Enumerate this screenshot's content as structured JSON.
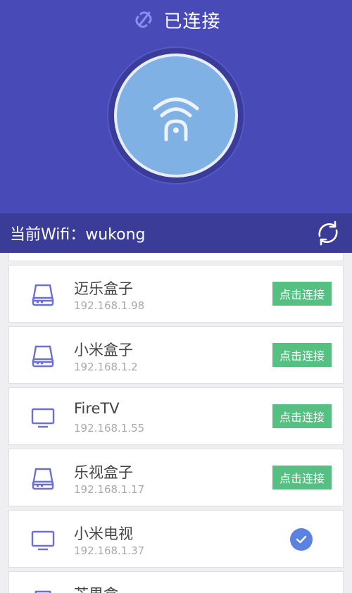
{
  "header": {
    "status_text": "已连接",
    "status_icon": "link-icon",
    "center_icon": "wifi-remote-icon"
  },
  "wifi_bar": {
    "current_wifi_text": "当前Wifi：wukong",
    "refresh_icon": "refresh-icon"
  },
  "colors": {
    "header_bg": "#484ab8",
    "bar_bg": "#3b3c98",
    "button_green": "#56c083",
    "check_blue": "#5b82e0",
    "icon_purple": "#6c6fd6"
  },
  "devices": [
    {
      "name": "迈乐盒子",
      "ip": "192.168.1.98",
      "icon": "box-icon",
      "action": "点击连接"
    },
    {
      "name": "小米盒子",
      "ip": "192.168.1.2",
      "icon": "box-icon",
      "action": "点击连接"
    },
    {
      "name": "FireTV",
      "ip": "192.168.1.55",
      "icon": "tv-icon",
      "action": "点击连接"
    },
    {
      "name": "乐视盒子",
      "ip": "192.168.1.17",
      "icon": "box-icon",
      "action": "点击连接"
    },
    {
      "name": "小米电视",
      "ip": "192.168.1.37",
      "icon": "tv-icon",
      "connected": true
    },
    {
      "name": "芒果盒",
      "icon": "box-icon"
    }
  ]
}
